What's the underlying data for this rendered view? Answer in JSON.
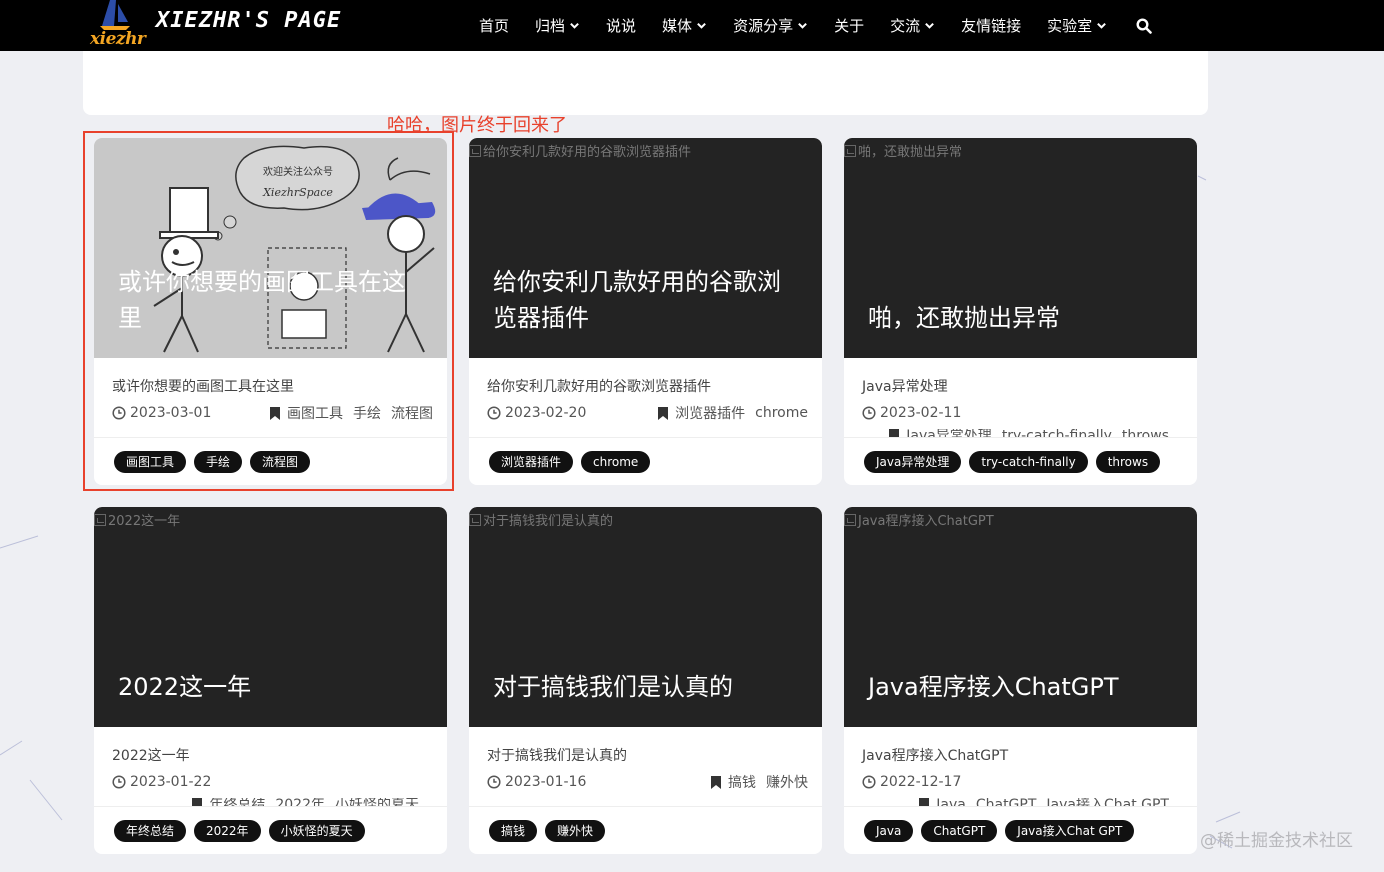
{
  "header": {
    "logo_text": "xiezhr",
    "site_title": "XIEZHR'S PAGE",
    "nav": [
      {
        "label": "首页",
        "dropdown": false
      },
      {
        "label": "归档",
        "dropdown": true
      },
      {
        "label": "说说",
        "dropdown": false
      },
      {
        "label": "媒体",
        "dropdown": true
      },
      {
        "label": "资源分享",
        "dropdown": true
      },
      {
        "label": "关于",
        "dropdown": false
      },
      {
        "label": "交流",
        "dropdown": true
      },
      {
        "label": "友情链接",
        "dropdown": false
      },
      {
        "label": "实验室",
        "dropdown": true
      }
    ]
  },
  "annotation": "哈哈，图片终于回来了",
  "sketch": {
    "bubble_line1": "欢迎关注公众号",
    "bubble_line2": "XiezhrSpace"
  },
  "cards": [
    {
      "cover_alt": "",
      "cover_title": "或许你想要的画图工具在这里",
      "excerpt": "或许你想要的画图工具在这里",
      "date": "2023-03-01",
      "categories": [
        "画图工具",
        "手绘",
        "流程图"
      ],
      "tags": [
        "画图工具",
        "手绘",
        "流程图"
      ]
    },
    {
      "cover_alt": "给你安利几款好用的谷歌浏览器插件",
      "cover_title": "给你安利几款好用的谷歌浏览器插件",
      "excerpt": "给你安利几款好用的谷歌浏览器插件",
      "date": "2023-02-20",
      "categories": [
        "浏览器插件",
        "chrome"
      ],
      "tags": [
        "浏览器插件",
        "chrome"
      ]
    },
    {
      "cover_alt": "啪，还敢抛出异常",
      "cover_title": "啪，还敢抛出异常",
      "excerpt": "Java异常处理",
      "date": "2023-02-11",
      "categories": [
        "Java异常处理",
        "try-catch-finally",
        "throws"
      ],
      "tags": [
        "Java异常处理",
        "try-catch-finally",
        "throws"
      ]
    },
    {
      "cover_alt": "2022这一年",
      "cover_title": "2022这一年",
      "excerpt": "2022这一年",
      "date": "2023-01-22",
      "categories": [
        "年终总结",
        "2022年",
        "小妖怪的夏天"
      ],
      "tags": [
        "年终总结",
        "2022年",
        "小妖怪的夏天"
      ]
    },
    {
      "cover_alt": "对于搞钱我们是认真的",
      "cover_title": "对于搞钱我们是认真的",
      "excerpt": "对于搞钱我们是认真的",
      "date": "2023-01-16",
      "categories": [
        "搞钱",
        "赚外快"
      ],
      "tags": [
        "搞钱",
        "赚外快"
      ]
    },
    {
      "cover_alt": "Java程序接入ChatGPT",
      "cover_title": "Java程序接入ChatGPT",
      "excerpt": "Java程序接入ChatGPT",
      "date": "2022-12-17",
      "categories": [
        "Java",
        "ChatGPT",
        "Java接入Chat GPT"
      ],
      "tags": [
        "Java",
        "ChatGPT",
        "Java接入Chat GPT"
      ]
    }
  ],
  "watermark": "@稀土掘金技术社区"
}
